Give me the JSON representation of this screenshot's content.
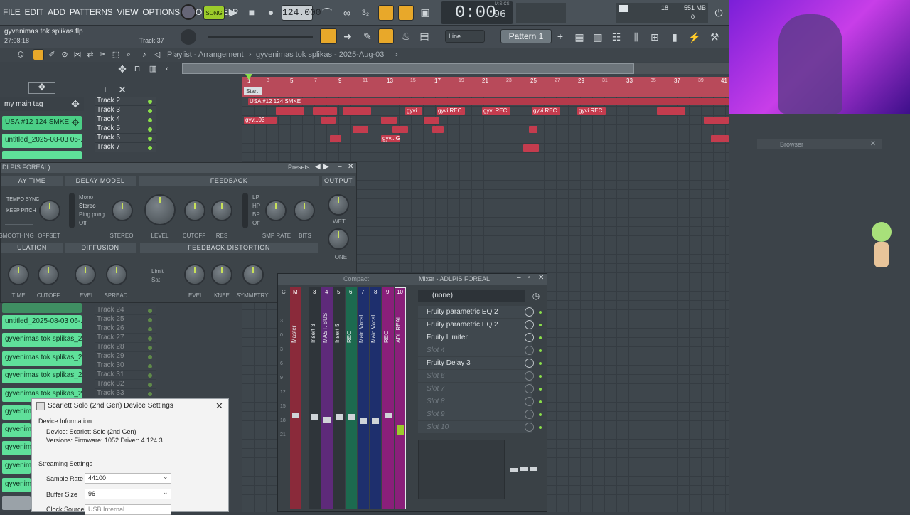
{
  "menu": [
    "FILE",
    "EDIT",
    "ADD",
    "PATTERNS",
    "VIEW",
    "OPTIONS",
    "TOOLS",
    "HELP"
  ],
  "transport": {
    "mode": "SONG",
    "tempo": "124.000",
    "time": "0:00",
    "time_sub": "96",
    "time_unit": "M:S:CS",
    "cpu": "18",
    "mem": "551 MB",
    "poly": "0"
  },
  "file": {
    "name": "gyvenimas tok splikas.flp",
    "time": "27:08:18",
    "track": "Track 37"
  },
  "toolbar2": {
    "snap": "Line",
    "pattern": "Pattern 1"
  },
  "playlist": {
    "title": "Playlist - Arrangement",
    "sep": "›",
    "project": "gyvenimas tok splikas - 2025-Aug-03",
    "start": "Start",
    "marker_label": "USA #12 124 SMKE"
  },
  "ruler": [
    "1",
    "5",
    "9",
    "13",
    "17",
    "21",
    "25",
    "29",
    "33",
    "37",
    "41"
  ],
  "ruler_odd": [
    "3",
    "7",
    "11",
    "15",
    "19",
    "23",
    "27",
    "31",
    "35",
    "39"
  ],
  "tag": "my main tag",
  "patterns": [
    "USA #12 124 SMKE",
    "untitled_2025-08-03 06-..."
  ],
  "patterns_lower": [
    "untitled_2025-08-03 06-...",
    "gyvenimas tok splikas_20...",
    "gyvenimas tok splikas_20...",
    "gyvenimas tok splikas_20...",
    "gyvenimas tok splikas_20...",
    "gyvenima",
    "gyvenima",
    "gyvenima",
    "gyvenima",
    "gyvenima"
  ],
  "tracks": [
    "Track 2",
    "Track 3",
    "Track 4",
    "Track 5",
    "Track 6",
    "Track 7"
  ],
  "tracks_lower": [
    "Track 24",
    "Track 25",
    "Track 26",
    "Track 27",
    "Track 28",
    "Track 29",
    "Track 30",
    "Track 31",
    "Track 32",
    "Track 33"
  ],
  "clips": {
    "usa": "USA #12 124 SMKE",
    "gyv": "gyvi REC",
    "gy": "gyv...03",
    "gc": "gyvi...G",
    "gch": "gyv...G"
  },
  "plugin": {
    "title": "DLPIS FOREAL)",
    "presets": "Presets",
    "sections": {
      "delay_time": "AY TIME",
      "delay_model": "DELAY MODEL",
      "feedback": "FEEDBACK",
      "output": "OUTPUT",
      "modulation": "ULATION",
      "diffusion": "DIFFUSION",
      "fb_distortion": "FEEDBACK DISTORTION"
    },
    "tempo_sync": "TEMPO SYNC",
    "keep_pitch": "KEEP PITCH",
    "smoothing": "SMOOTHING",
    "offset": "OFFSET",
    "models": [
      "Mono",
      "Stereo",
      "Ping pong",
      "Off"
    ],
    "stereo": "STEREO",
    "level": "LEVEL",
    "cutoff": "CUTOFF",
    "res": "RES",
    "filters": [
      "LP",
      "HP",
      "BP",
      "Off"
    ],
    "smp_rate": "SMP RATE",
    "bits": "BITS",
    "wet": "WET",
    "tone": "TONE",
    "time": "TIME",
    "cutoff2": "CUTOFF",
    "level2": "LEVEL",
    "spread": "SPREAD",
    "limit": "Limit",
    "sat": "Sat",
    "level3": "LEVEL",
    "knee": "KNEE",
    "symmetry": "SYMMETRY"
  },
  "mixer": {
    "title": "Mixer - ADLPIS FOREAL",
    "compact": "Compact",
    "preset": "(none)",
    "channel_nums": [
      "C",
      "M",
      "3",
      "4",
      "5",
      "6",
      "7",
      "8",
      "9",
      "10"
    ],
    "channel_names": [
      "Master",
      "Insert 3",
      "MAST. BUS",
      "Insert 5",
      "REC",
      "Main Vocal",
      "Main Vocal",
      "REC",
      "ADL REAL"
    ],
    "db": [
      "3",
      "0",
      "3",
      "6",
      "9",
      "12",
      "15",
      "18",
      "21",
      "24",
      "27",
      "30"
    ],
    "slots": [
      {
        "name": "Fruity parametric EQ 2",
        "empty": false
      },
      {
        "name": "Fruity parametric EQ 2",
        "empty": false
      },
      {
        "name": "Fruity Limiter",
        "empty": false
      },
      {
        "name": "Slot 4",
        "empty": true
      },
      {
        "name": "Fruity Delay 3",
        "empty": false
      },
      {
        "name": "Slot 6",
        "empty": true
      },
      {
        "name": "Slot 7",
        "empty": true
      },
      {
        "name": "Slot 8",
        "empty": true
      },
      {
        "name": "Slot 9",
        "empty": true
      },
      {
        "name": "Slot 10",
        "empty": true
      }
    ]
  },
  "dialog": {
    "title": "Scarlett Solo (2nd Gen) Device Settings",
    "info_head": "Device Information",
    "device": "Device: Scarlett Solo (2nd Gen)",
    "versions": "Versions: Firmware: 1052  Driver: 4.124.3",
    "stream_head": "Streaming Settings",
    "sample_rate_label": "Sample Rate",
    "sample_rate": "44100",
    "buffer_label": "Buffer Size",
    "buffer": "96",
    "clock_label": "Clock Source",
    "clock": "USB Internal"
  },
  "browser": "Browser",
  "colors": {
    "accent": "#c43c4e",
    "pattern": "#5fe09a",
    "led": "#8be04a"
  }
}
